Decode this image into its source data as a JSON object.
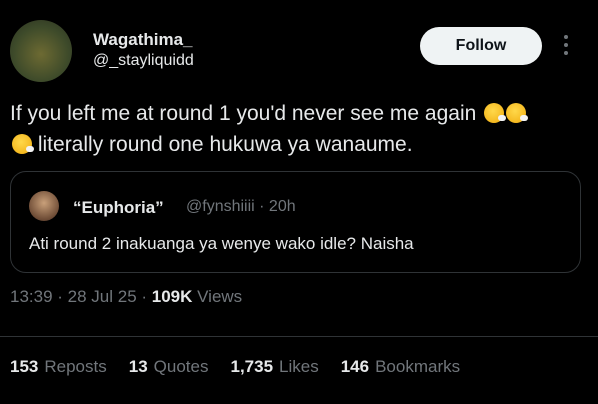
{
  "author": {
    "name": "Wagathima_",
    "handle": "@_stayliquidd",
    "follow_label": "Follow"
  },
  "tweet": {
    "line1": "If you left me at round 1 you'd never see me again",
    "line2": "literally round one hukuwa ya wanaume."
  },
  "quoted": {
    "name": "“Euphoria”",
    "handle": "@fynshiiii · 20h",
    "text": "Ati round 2 inakuanga ya wenye wako idle? Naisha"
  },
  "meta": {
    "time": "13:39",
    "sep1": " · ",
    "date": "28 Jul 25",
    "sep2": " · ",
    "views": "109K",
    "views_label": " Views"
  },
  "stats": [
    {
      "count": "153",
      "label": "Reposts"
    },
    {
      "count": "13",
      "label": "Quotes"
    },
    {
      "count": "1,735",
      "label": "Likes"
    },
    {
      "count": "146",
      "label": "Bookmarks"
    }
  ]
}
